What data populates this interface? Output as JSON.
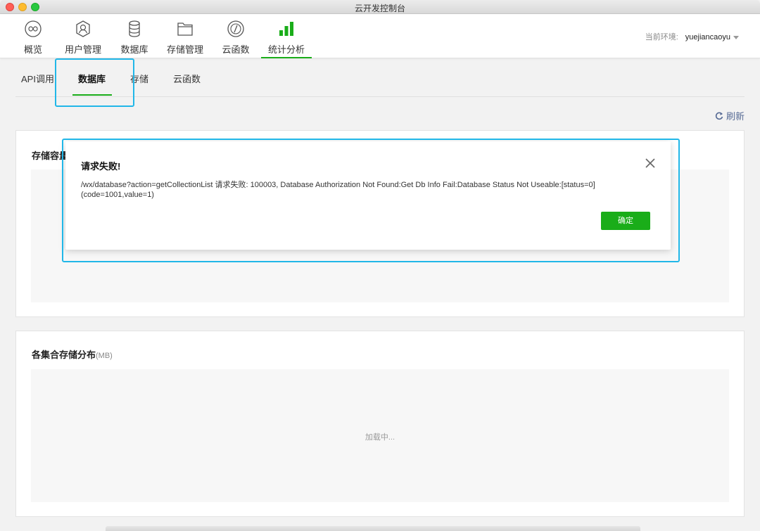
{
  "window": {
    "title": "云开发控制台"
  },
  "nav": [
    {
      "label": "概览",
      "icon": "infinity-icon"
    },
    {
      "label": "用户管理",
      "icon": "user-icon"
    },
    {
      "label": "数据库",
      "icon": "database-icon"
    },
    {
      "label": "存储管理",
      "icon": "folder-icon"
    },
    {
      "label": "云函数",
      "icon": "code-icon"
    },
    {
      "label": "统计分析",
      "icon": "bar-chart-icon",
      "active": true
    }
  ],
  "env": {
    "label": "当前环境:",
    "value": "yuejiancaoyu"
  },
  "subtabs": [
    {
      "label": "API调用"
    },
    {
      "label": "数据库",
      "active": true
    },
    {
      "label": "存储"
    },
    {
      "label": "云函数"
    }
  ],
  "refresh_label": "刷新",
  "card1": {
    "title": "存储容量"
  },
  "card2": {
    "title": "各集合存储分布",
    "unit": "(MB)",
    "loading": "加载中..."
  },
  "dialog": {
    "title": "请求失败!",
    "message": "/wx/database?action=getCollectionList 请求失败: 100003, Database Authorization Not Found:Get Db Info Fail:Database Status Not Useable:[status=0](code=1001,value=1)",
    "confirm": "确定"
  },
  "colors": {
    "accent": "#1aad19",
    "highlight": "#21b7e8",
    "link": "#576b95"
  }
}
